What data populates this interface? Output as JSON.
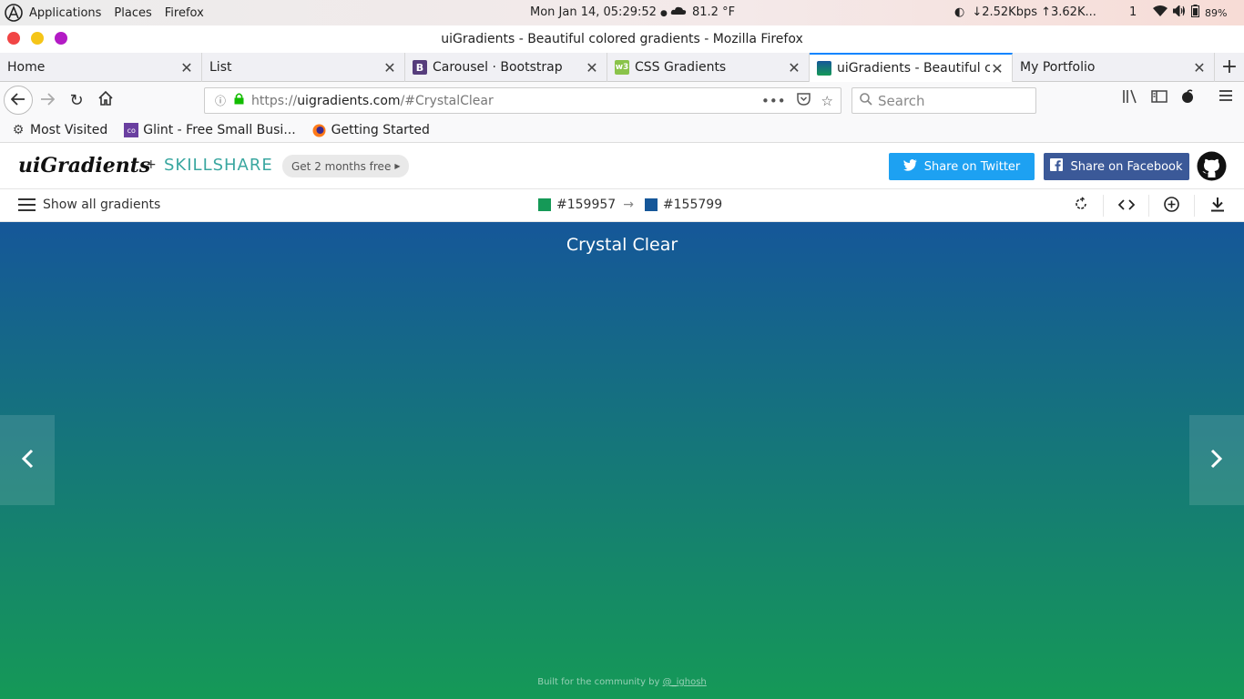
{
  "panel": {
    "menus": [
      "Applications",
      "Places",
      "Firefox"
    ],
    "clock": "Mon Jan 14, 05:29:52",
    "weather": "81.2 °F",
    "net": "↓2.52Kbps ↑3.62K...",
    "workspace": "1",
    "battery": "89%"
  },
  "window": {
    "title": "uiGradients - Beautiful colored gradients - Mozilla Firefox"
  },
  "tabs": [
    {
      "label": "Home",
      "favicon": "",
      "color": ""
    },
    {
      "label": "List",
      "favicon": "",
      "color": ""
    },
    {
      "label": "Carousel · Bootstrap",
      "favicon": "B",
      "color": "#563d7c"
    },
    {
      "label": "CSS Gradients",
      "favicon": "w3",
      "color": "#8ac34a"
    },
    {
      "label": "uiGradients - Beautiful co",
      "favicon": "",
      "color": "#155799"
    },
    {
      "label": "My Portfolio",
      "favicon": "",
      "color": ""
    }
  ],
  "navbar": {
    "url_prefix": "https://",
    "url_host": "uigradients.com",
    "url_path": "/#CrystalClear",
    "search_placeholder": "Search"
  },
  "bookmarks": [
    {
      "label": "Most Visited",
      "icon": "gear-icon"
    },
    {
      "label": "Glint - Free Small Busi...",
      "icon": "colorlib-icon"
    },
    {
      "label": "Getting Started",
      "icon": "firefox-icon"
    }
  ],
  "site": {
    "brand": "uiGradients",
    "plus": "+",
    "partner": "SKILLSHARE",
    "promo": "Get 2 months free",
    "twitter": "Share on Twitter",
    "facebook": "Share on Facebook"
  },
  "toolbar": {
    "show_all": "Show all gradients",
    "color1": "#159957",
    "color2": "#155799",
    "arrow": "→"
  },
  "gradient": {
    "name": "Crystal Clear",
    "footer_prefix": "Built for the community by",
    "footer_author": "@_ighosh"
  }
}
